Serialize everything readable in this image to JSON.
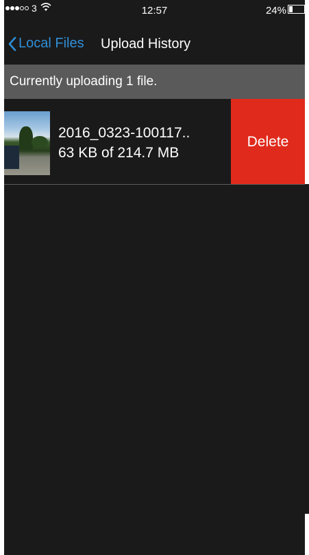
{
  "status_bar": {
    "signal_bars_filled": 3,
    "signal_bars_total": 5,
    "carrier": "3",
    "wifi_icon": "wifi-icon",
    "time": "12:57",
    "battery_percent": "24%",
    "battery_level": 0.24
  },
  "nav": {
    "back_label": "Local Files",
    "back_icon": "chevron-left-icon",
    "title": "Upload History",
    "accent_color": "#2f8fd8"
  },
  "banner": {
    "text": "Currently uploading 1 file."
  },
  "upload_items": [
    {
      "file_name": "2016_0323-100117..",
      "progress_text": "63 KB of 214.7 MB",
      "delete_label": "Delete",
      "delete_color": "#e02a1c"
    }
  ]
}
